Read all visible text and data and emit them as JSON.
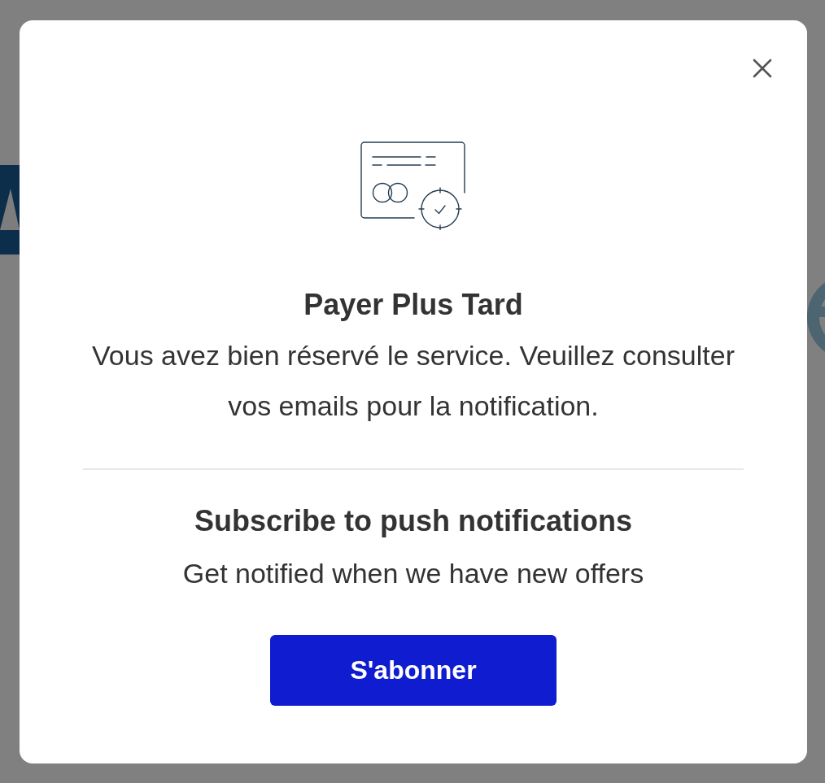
{
  "dialog": {
    "title": "Payer Plus Tard",
    "message": "Vous avez bien réservé le service. Veuillez consulter vos emails pour la notification.",
    "subscribe": {
      "title": "Subscribe to push notifications",
      "description": "Get notified when we have new offers",
      "button": "S'abonner"
    }
  }
}
